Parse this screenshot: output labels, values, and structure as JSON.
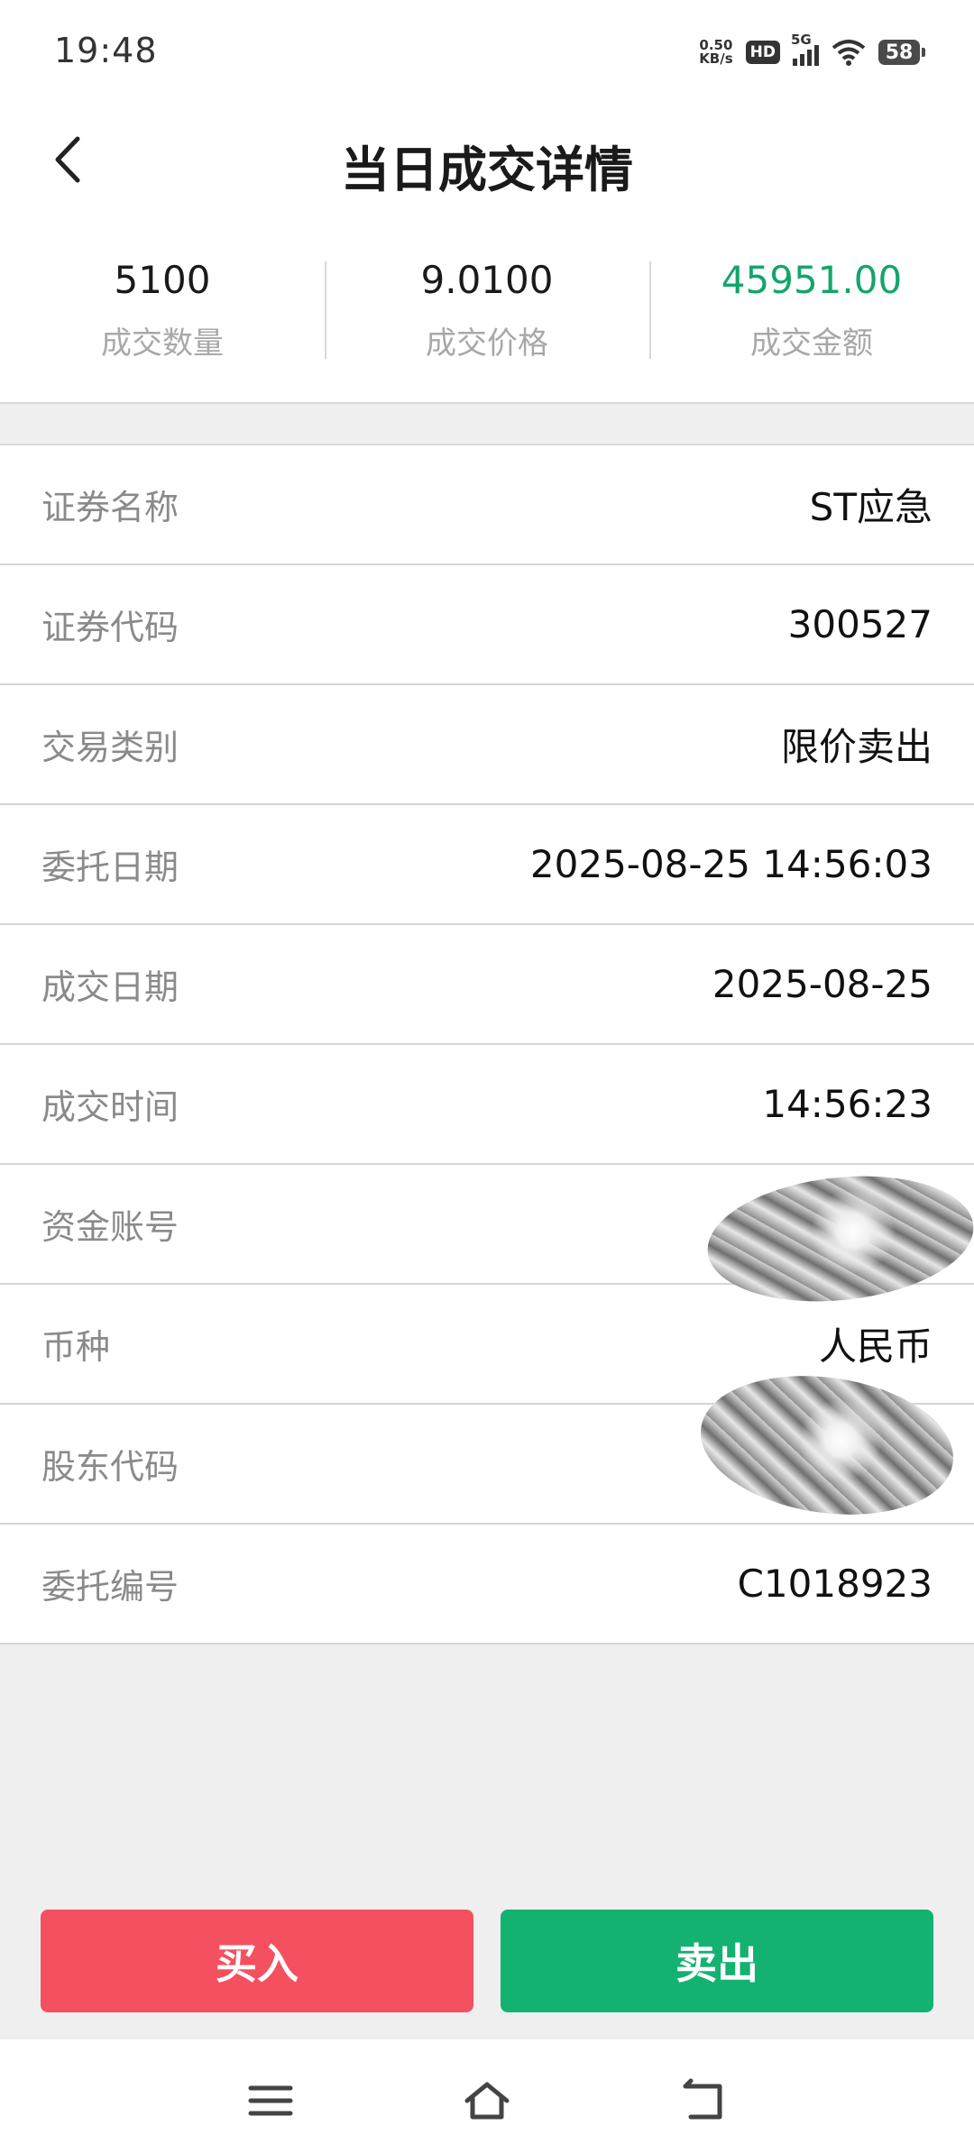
{
  "status_bar": {
    "time": "19:48",
    "net_speed_value": "0.50",
    "net_speed_unit": "KB/s",
    "hd": "HD",
    "signal": "5G",
    "battery": "58"
  },
  "header": {
    "title": "当日成交详情",
    "back_icon": "chevron-left-icon"
  },
  "summary": [
    {
      "value": "5100",
      "label": "成交数量"
    },
    {
      "value": "9.0100",
      "label": "成交价格"
    },
    {
      "value": "45951.00",
      "label": "成交金额",
      "color": "#14a56b"
    }
  ],
  "details": [
    {
      "label": "证券名称",
      "value": "ST应急"
    },
    {
      "label": "证券代码",
      "value": "300527"
    },
    {
      "label": "交易类别",
      "value": "限价卖出"
    },
    {
      "label": "委托日期",
      "value": "2025-08-25 14:56:03"
    },
    {
      "label": "成交日期",
      "value": "2025-08-25"
    },
    {
      "label": "成交时间",
      "value": "14:56:23"
    },
    {
      "label": "资金账号",
      "value": ""
    },
    {
      "label": "币种",
      "value": "人民币"
    },
    {
      "label": "股东代码",
      "value": ""
    },
    {
      "label": "委托编号",
      "value": "C1018923"
    }
  ],
  "actions": {
    "buy": "买入",
    "sell": "卖出"
  },
  "colors": {
    "buy": "#f5505f",
    "sell": "#13b271",
    "amount": "#14a56b"
  },
  "system_nav": [
    "menu-icon",
    "home-icon",
    "back-icon"
  ]
}
